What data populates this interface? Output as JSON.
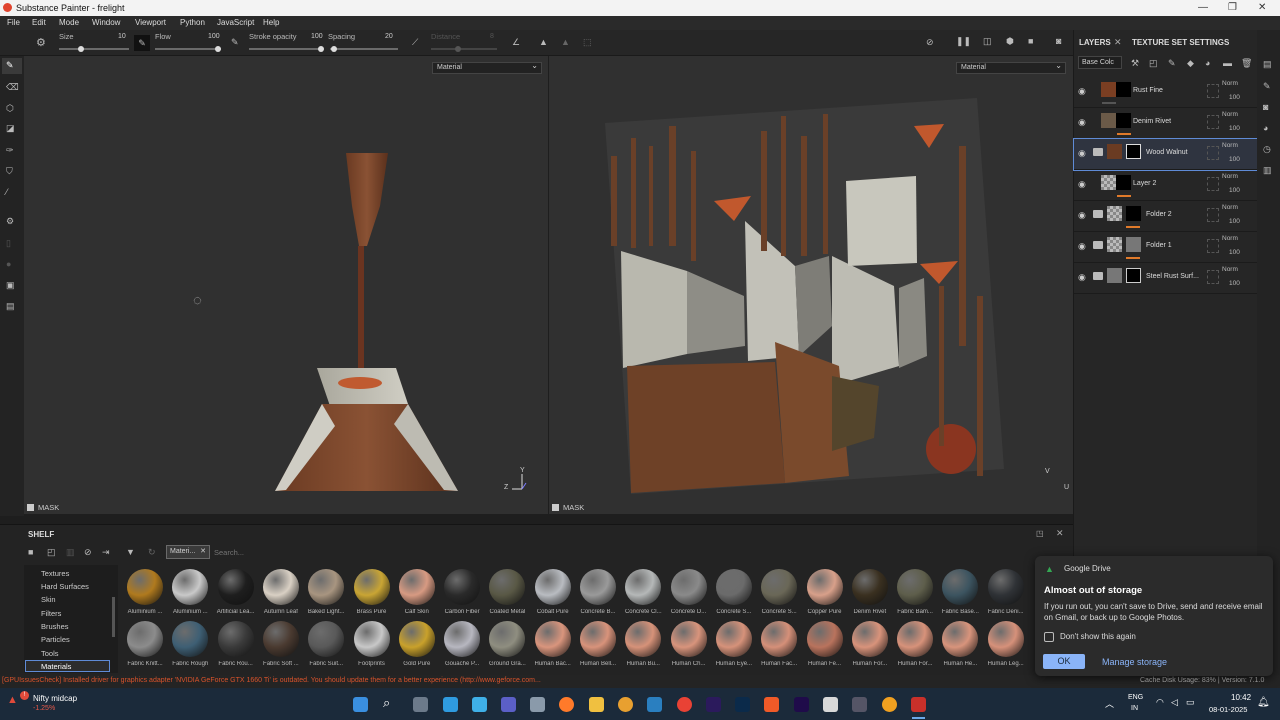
{
  "window": {
    "title": "Substance Painter - frelight"
  },
  "menu": [
    "File",
    "Edit",
    "Mode",
    "Window",
    "Viewport",
    "Python",
    "JavaScript",
    "Help"
  ],
  "toolbar": {
    "size_label": "Size",
    "size_value": "10",
    "flow_label": "Flow",
    "flow_value": "100",
    "stroke_opacity_label": "Stroke opacity",
    "stroke_opacity_value": "100",
    "spacing_label": "Spacing",
    "spacing_value": "20",
    "distance_label": "Distance",
    "distance_value": "8"
  },
  "viewport_left": {
    "dropdown": "Material",
    "mask_label": "MASK",
    "gizmo_y": "Y",
    "gizmo_z": "Z"
  },
  "viewport_right": {
    "dropdown": "Material",
    "mask_label": "MASK",
    "gizmo_v": "V",
    "gizmo_u": "U"
  },
  "layers_panel": {
    "tab_layers": "LAYERS",
    "tab_texture_set": "TEXTURE SET SETTINGS",
    "channel_dropdown": "Base Colc",
    "layers": [
      {
        "name": "Rust Fine",
        "blend": "Norm",
        "opacity": "100",
        "folder": false,
        "selected": false
      },
      {
        "name": "Denim Rivet",
        "blend": "Norm",
        "opacity": "100",
        "folder": false,
        "selected": false
      },
      {
        "name": "Wood Walnut",
        "blend": "Norm",
        "opacity": "100",
        "folder": true,
        "selected": true
      },
      {
        "name": "Layer 2",
        "blend": "Norm",
        "opacity": "100",
        "folder": false,
        "selected": false
      },
      {
        "name": "Folder 2",
        "blend": "Norm",
        "opacity": "100",
        "folder": true,
        "selected": false
      },
      {
        "name": "Folder 1",
        "blend": "Norm",
        "opacity": "100",
        "folder": true,
        "selected": false
      },
      {
        "name": "Steel Rust Surf...",
        "blend": "Norm",
        "opacity": "100",
        "folder": true,
        "selected": false
      }
    ]
  },
  "shelf": {
    "title": "SHELF",
    "filter_chip": "Materi...",
    "search_placeholder": "Search...",
    "categories": [
      "Textures",
      "Hard Surfaces",
      "Skin",
      "Filters",
      "Brushes",
      "Particles",
      "Tools",
      "Materials"
    ],
    "selected_category": "Materials",
    "row1": [
      {
        "label": "Aluminium ...",
        "color": "#b07a1e"
      },
      {
        "label": "Aluminium ...",
        "color": "#c9c9c9"
      },
      {
        "label": "Artificial Lea...",
        "color": "#1e1e1e"
      },
      {
        "label": "Autumn Leaf",
        "color": "#d9d0c4"
      },
      {
        "label": "Baked Light...",
        "color": "#a89580"
      },
      {
        "label": "Brass Pure",
        "color": "#c9a534"
      },
      {
        "label": "Calf Skin",
        "color": "#d79a82"
      },
      {
        "label": "Carbon Fiber",
        "color": "#2a2a2a"
      },
      {
        "label": "Coated Metal",
        "color": "#595845"
      },
      {
        "label": "Cobalt Pure",
        "color": "#b9bcc1"
      },
      {
        "label": "Concrete B...",
        "color": "#9a9a9a"
      },
      {
        "label": "Concrete Cl...",
        "color": "#b5b8b8"
      },
      {
        "label": "Concrete D...",
        "color": "#8a8a8a"
      },
      {
        "label": "Concrete S...",
        "color": "#6b6b6b"
      },
      {
        "label": "Concrete S...",
        "color": "#6a6757"
      },
      {
        "label": "Copper Pure",
        "color": "#d8a08a"
      },
      {
        "label": "Denim Rivet",
        "color": "#3a3020"
      },
      {
        "label": "Fabric Bam...",
        "color": "#5e5e4b"
      },
      {
        "label": "Fabric Base...",
        "color": "#3c5460"
      },
      {
        "label": "Fabric Deni...",
        "color": "#2f3236"
      }
    ],
    "row2": [
      {
        "label": "Fabric Knitt...",
        "color": "#8c8c8c"
      },
      {
        "label": "Fabric Rough",
        "color": "#3e5f74"
      },
      {
        "label": "Fabric Rou...",
        "color": "#3a3a3a"
      },
      {
        "label": "Fabric Soft ...",
        "color": "#4a3a30"
      },
      {
        "label": "Fabric Suit...",
        "color": "#595959"
      },
      {
        "label": "Footprints",
        "color": "#c8c8c8"
      },
      {
        "label": "Gold Pure",
        "color": "#c9a12b"
      },
      {
        "label": "Gouache P...",
        "color": "#b7b7c0"
      },
      {
        "label": "Ground Gra...",
        "color": "#8f8e80"
      },
      {
        "label": "Human Bac...",
        "color": "#d9957d"
      },
      {
        "label": "Human Bell...",
        "color": "#d8937b"
      },
      {
        "label": "Human Bu...",
        "color": "#d69279"
      },
      {
        "label": "Human Ch...",
        "color": "#d8947c"
      },
      {
        "label": "Human Eye...",
        "color": "#d6927a"
      },
      {
        "label": "Human Fac...",
        "color": "#d59079"
      },
      {
        "label": "Human Fe...",
        "color": "#b9735d"
      },
      {
        "label": "Human For...",
        "color": "#d8937b"
      },
      {
        "label": "Human For...",
        "color": "#d7927a"
      },
      {
        "label": "Human He...",
        "color": "#d8947c"
      },
      {
        "label": "Human Leg...",
        "color": "#d6917a"
      }
    ]
  },
  "notification": {
    "app": "Google Drive",
    "title": "Almost out of storage",
    "body": "If you run out, you can't save to Drive, send and receive email on Gmail, or back up to Google Photos.",
    "checkbox_label": "Don't show this again",
    "ok_label": "OK",
    "manage_label": "Manage storage"
  },
  "log": {
    "message": "[GPUIssuesCheck] Installed driver for graphics adapter 'NVIDIA GeForce GTX 1660 Ti' is outdated. You should update them for a better experience (http://www.geforce.com...",
    "disk_usage": "Cache Disk Usage:   83% | Version: 7.1.0"
  },
  "taskbar": {
    "ticker_name": "Nifty midcap",
    "ticker_change": "-1.25%",
    "lang1": "ENG",
    "lang2": "IN",
    "time": "10:42",
    "date": "08-01-2025"
  },
  "colors": {
    "accent": "#5f8bd6",
    "orange": "#e07a2a",
    "log_error": "#d9532b",
    "ok_button": "#8ab4f8"
  }
}
